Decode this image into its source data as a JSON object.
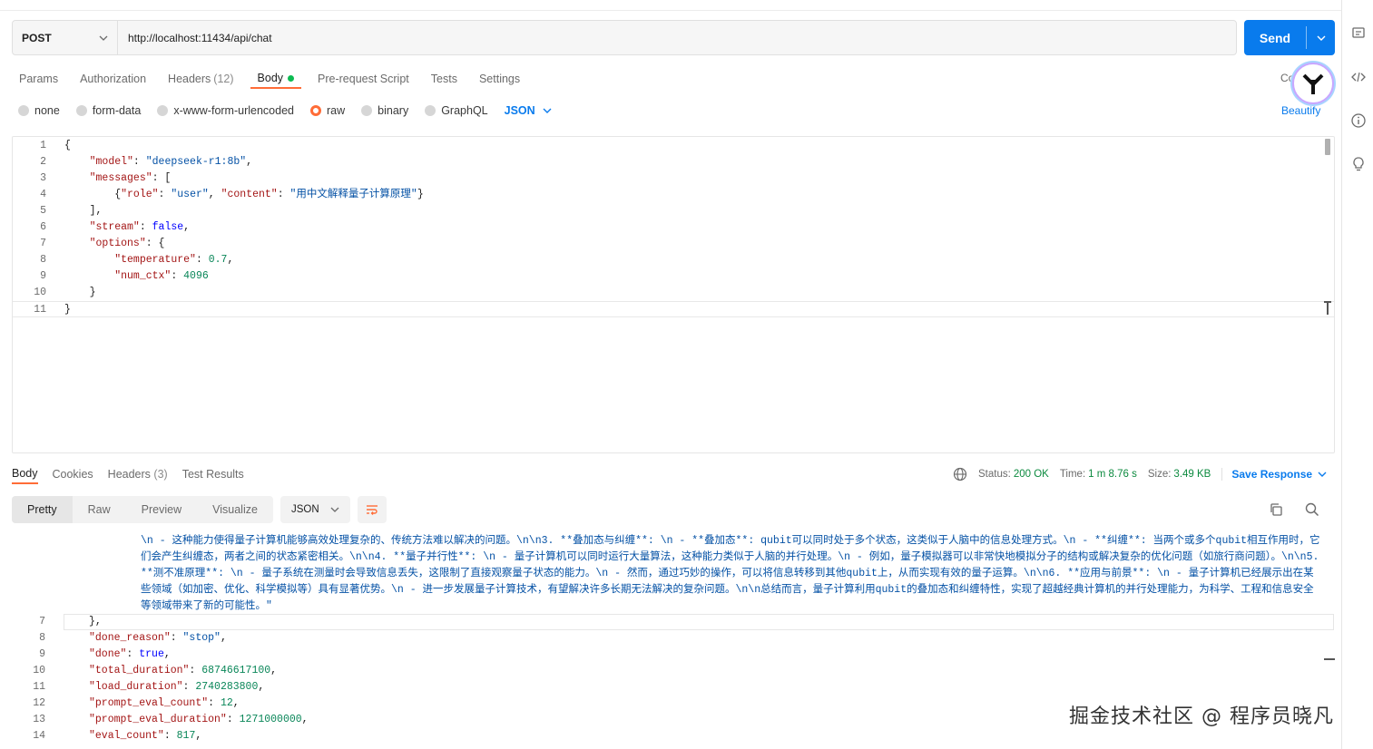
{
  "request": {
    "method": "POST",
    "url": "http://localhost:11434/api/chat",
    "send_label": "Send"
  },
  "request_tabs": {
    "params": "Params",
    "authorization": "Authorization",
    "headers": "Headers",
    "headers_count": "(12)",
    "body": "Body",
    "prerequest": "Pre-request Script",
    "tests": "Tests",
    "settings": "Settings",
    "cookies": "Cookies"
  },
  "body_options": {
    "none": "none",
    "form_data": "form-data",
    "urlencoded": "x-www-form-urlencoded",
    "raw": "raw",
    "binary": "binary",
    "graphql": "GraphQL",
    "format": "JSON",
    "beautify": "Beautify"
  },
  "request_body": {
    "line_numbers": [
      "1",
      "2",
      "3",
      "4",
      "5",
      "6",
      "7",
      "8",
      "9",
      "10",
      "11"
    ],
    "model_key": "\"model\"",
    "model_val": "\"deepseek-r1:8b\"",
    "messages_key": "\"messages\"",
    "role_key": "\"role\"",
    "role_val": "\"user\"",
    "content_key": "\"content\"",
    "content_val": "\"用中文解释量子计算原理\"",
    "stream_key": "\"stream\"",
    "stream_val": "false",
    "options_key": "\"options\"",
    "temperature_key": "\"temperature\"",
    "temperature_val": "0.7",
    "num_ctx_key": "\"num_ctx\"",
    "num_ctx_val": "4096"
  },
  "response_tabs": {
    "body": "Body",
    "cookies": "Cookies",
    "headers": "Headers",
    "headers_count": "(3)",
    "test_results": "Test Results"
  },
  "response_status": {
    "status_label": "Status:",
    "status_value": "200 OK",
    "time_label": "Time:",
    "time_value": "1 m 8.76 s",
    "size_label": "Size:",
    "size_value": "3.49 KB",
    "save_response": "Save Response"
  },
  "view_tabs": {
    "pretty": "Pretty",
    "raw": "Raw",
    "preview": "Preview",
    "visualize": "Visualize",
    "format": "JSON"
  },
  "response_body": {
    "wrapped_text": "\\n    - 这种能力使得量子计算机能够高效处理复杂的、传统方法难以解决的问题。\\n\\n3. **叠加态与纠缠**: \\n    - **叠加态**: qubit可以同时处于多个状态，这类似于人脑中的信息处理方式。\\n    - **纠缠**: 当两个或多个qubit相互作用时，它们会产生纠缠态，两者之间的状态紧密相关。\\n\\n4. **量子并行性**: \\n    - 量子计算机可以同时运行大量算法，这种能力类似于人脑的并行处理。\\n    - 例如，量子模拟器可以非常快地模拟分子的结构或解决复杂的优化问题（如旅行商问题）。\\n\\n5. **测不准原理**: \\n    - 量子系统在测量时会导致信息丢失，这限制了直接观察量子状态的能力。\\n    - 然而，通过巧妙的操作，可以将信息转移到其他qubit上，从而实现有效的量子运算。\\n\\n6. **应用与前景**: \\n    - 量子计算机已经展示出在某些领域（如加密、优化、科学模拟等）具有显著优势。\\n    - 进一步发展量子计算技术，有望解决许多长期无法解决的复杂问题。\\n\\n总结而言，量子计算利用qubit的叠加态和纠缠特性，实现了超越经典计算机的并行处理能力，为科学、工程和信息安全等领域带来了新的可能性。\"",
    "line_7": "},",
    "done_reason_key": "\"done_reason\"",
    "done_reason_val": "\"stop\"",
    "done_key": "\"done\"",
    "done_val": "true",
    "total_duration_key": "\"total_duration\"",
    "total_duration_val": "68746617100",
    "load_duration_key": "\"load_duration\"",
    "load_duration_val": "2740283800",
    "prompt_eval_count_key": "\"prompt_eval_count\"",
    "prompt_eval_count_val": "12",
    "prompt_eval_duration_key": "\"prompt_eval_duration\"",
    "prompt_eval_duration_val": "1271000000",
    "eval_count_key": "\"eval_count\"",
    "eval_count_val": "817",
    "line_numbers": [
      "7",
      "8",
      "9",
      "10",
      "11",
      "12",
      "13",
      "14"
    ]
  },
  "watermark": "掘金技术社区 @ 程序员晓凡",
  "colors": {
    "accent": "#ff6c37",
    "send": "#097bed",
    "status_ok": "#0c8a3f"
  }
}
